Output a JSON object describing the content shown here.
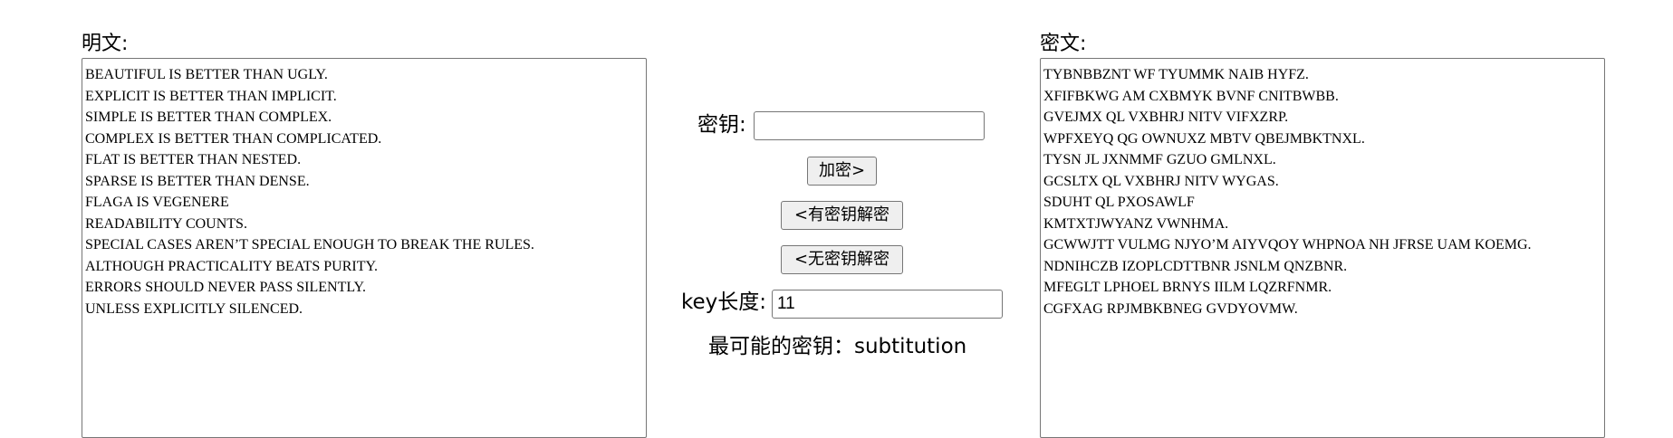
{
  "plaintext": {
    "label": "明文:",
    "lines": [
      "BEAUTIFUL IS BETTER THAN UGLY.",
      "EXPLICIT IS BETTER THAN IMPLICIT.",
      "SIMPLE IS BETTER THAN COMPLEX.",
      "COMPLEX IS BETTER THAN COMPLICATED.",
      "FLAT IS BETTER THAN NESTED.",
      "SPARSE IS BETTER THAN DENSE.",
      "FLAGA IS VEGENERE",
      "READABILITY COUNTS.",
      "SPECIAL CASES AREN’T SPECIAL ENOUGH TO BREAK THE RULES.",
      "ALTHOUGH PRACTICALITY BEATS PURITY.",
      "ERRORS SHOULD NEVER PASS SILENTLY.",
      "UNLESS EXPLICITLY SILENCED."
    ]
  },
  "ciphertext": {
    "label": "密文:",
    "lines": [
      "TYBNBBZNT WF TYUMMK NAIB HYFZ.",
      "XFIFBKWG AM CXBMYK BVNF CNITBWBB.",
      "GVEJMX QL VXBHRJ NITV VIFXZRP.",
      "WPFXEYQ QG OWNUXZ MBTV QBEJMBKTNXL.",
      "TYSN JL JXNMMF GZUO GMLNXL.",
      "GCSLTX QL VXBHRJ NITV WYGAS.",
      "SDUHT QL PXOSAWLF",
      "KMTXTJWYANZ VWNHMA.",
      "GCWWJTT VULMG NJYO’M AIYVQOY WHPNOA NH JFRSE UAM KOEMG.",
      "NDNIHCZB IZOPLCDTTBNR JSNLM QNZBNR.",
      "MFEGLT LPHOEL BRNYS IILM LQZRFNMR.",
      "CGFXAG RPJMBKBNEG GVDYOVMW."
    ]
  },
  "key": {
    "label": "密钥:",
    "value": ""
  },
  "buttons": {
    "encrypt": "加密>",
    "decrypt_with_key": "<有密钥解密",
    "decrypt_without_key": "<无密钥解密"
  },
  "key_length": {
    "label": "key长度:",
    "value": "11"
  },
  "best_key": {
    "text": "最可能的密钥：subtitution"
  }
}
